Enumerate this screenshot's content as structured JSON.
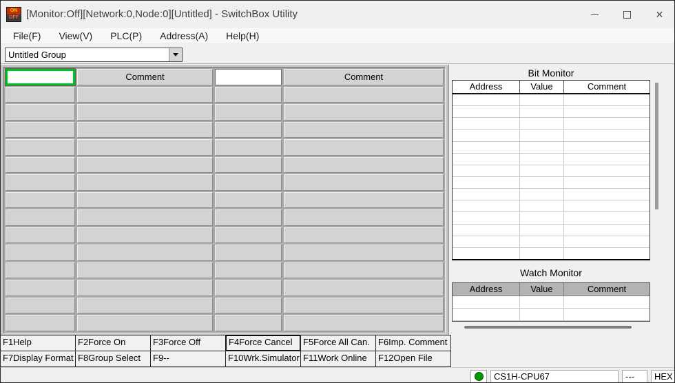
{
  "window": {
    "title": "[Monitor:Off][Network:0,Node:0][Untitled] - SwitchBox Utility",
    "icon": {
      "on": "ON",
      "off": "OFF"
    },
    "controls": {
      "close_glyph": "✕"
    }
  },
  "menu": {
    "items": [
      "File(F)",
      "View(V)",
      "PLC(P)",
      "Address(A)",
      "Help(H)"
    ]
  },
  "toolbar": {
    "group_value": "Untitled Group"
  },
  "grid": {
    "comment_header": "Comment",
    "total_rows": 15,
    "data_rows": 14,
    "selected_cell_border": "#00c41e"
  },
  "bit_monitor": {
    "title": "Bit Monitor",
    "columns": [
      "Address",
      "Value",
      "Comment"
    ],
    "empty_rows": 14
  },
  "watch_monitor": {
    "title": "Watch Monitor",
    "columns": [
      "Address",
      "Value",
      "Comment"
    ],
    "empty_rows": 2
  },
  "function_keys": {
    "rows": [
      [
        "F1Help",
        "F2Force On",
        "F3Force Off",
        "F4Force Cancel",
        "F5Force All Can.",
        "F6Imp. Comment"
      ],
      [
        "F7Display Format",
        "F8Group Select",
        "F9--",
        "F10Wrk.Simulator",
        "F11Work Online",
        "F12Open File"
      ]
    ],
    "focused": "F4Force Cancel"
  },
  "status_bar": {
    "plc_type": "CS1H-CPU67",
    "interval": "---",
    "format": "HEX",
    "connection_color": "#009700"
  }
}
